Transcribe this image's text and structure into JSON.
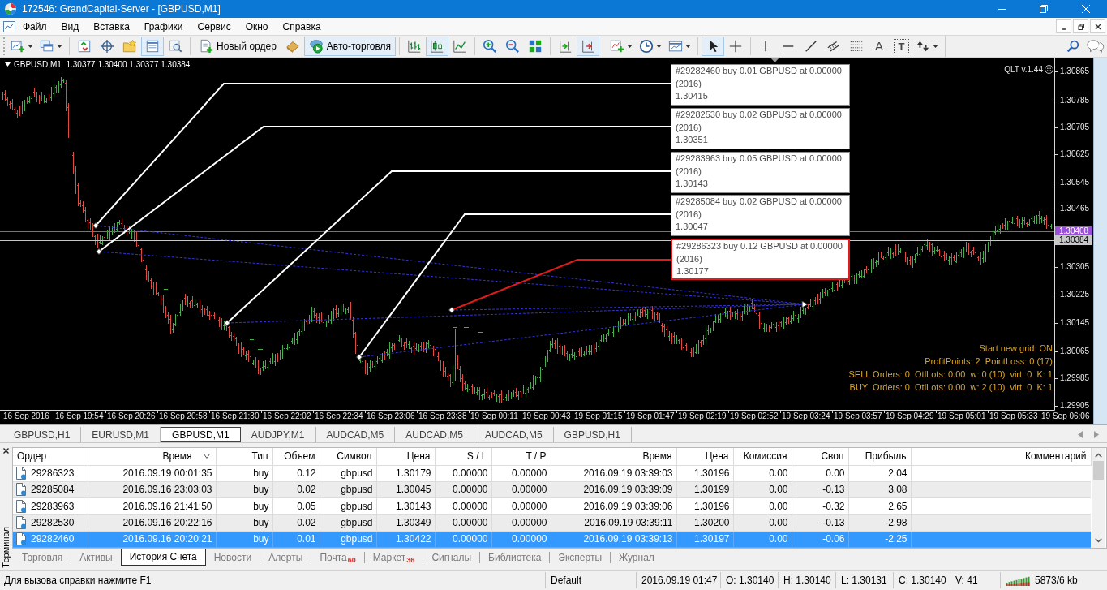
{
  "window": {
    "title": "172546: GrandCapital-Server - [GBPUSD,M1]"
  },
  "menu": [
    "Файл",
    "Вид",
    "Вставка",
    "Графики",
    "Сервис",
    "Окно",
    "Справка"
  ],
  "toolbar": {
    "groups": [
      [
        {
          "kind": "icon",
          "pressed": false,
          "dropdown": true
        },
        {
          "kind": "icon",
          "pressed": false,
          "dropdown": true
        }
      ],
      [
        {
          "kind": "icon",
          "pressed": false,
          "dropdown": false
        },
        {
          "kind": "icon",
          "pressed": false,
          "dropdown": false
        },
        {
          "kind": "icon",
          "pressed": false,
          "dropdown": false
        },
        {
          "kind": "icon",
          "pressed": true,
          "dropdown": false
        },
        {
          "kind": "icon",
          "pressed": false,
          "dropdown": false
        }
      ],
      [
        {
          "kind": "labeled",
          "label": "Новый ордер",
          "pressed": false,
          "dropdown": false
        },
        {
          "kind": "icon",
          "pressed": false,
          "dropdown": false
        },
        {
          "kind": "labeled",
          "label": "Авто-торговля",
          "pressed": true,
          "dropdown": false
        }
      ],
      [
        {
          "kind": "icon",
          "pressed": false,
          "dropdown": false
        },
        {
          "kind": "icon",
          "pressed": true,
          "dropdown": false
        },
        {
          "kind": "icon",
          "pressed": false,
          "dropdown": false
        }
      ],
      [
        {
          "kind": "icon",
          "pressed": false,
          "dropdown": false
        },
        {
          "kind": "icon",
          "pressed": false,
          "dropdown": false
        },
        {
          "kind": "icon",
          "pressed": false,
          "dropdown": false
        }
      ],
      [
        {
          "kind": "icon",
          "pressed": false,
          "dropdown": false
        },
        {
          "kind": "icon",
          "pressed": true,
          "dropdown": false
        }
      ],
      [
        {
          "kind": "icon",
          "pressed": false,
          "dropdown": true
        },
        {
          "kind": "icon",
          "pressed": false,
          "dropdown": true
        },
        {
          "kind": "icon",
          "pressed": false,
          "dropdown": true
        }
      ],
      [
        {
          "kind": "icon",
          "pressed": true,
          "dropdown": false
        },
        {
          "kind": "icon",
          "pressed": false,
          "dropdown": false
        }
      ],
      [
        {
          "kind": "icon",
          "pressed": false,
          "dropdown": false
        },
        {
          "kind": "icon",
          "pressed": false,
          "dropdown": false
        },
        {
          "kind": "icon",
          "pressed": false,
          "dropdown": false
        },
        {
          "kind": "icon",
          "pressed": false,
          "dropdown": false
        },
        {
          "kind": "icon",
          "pressed": false,
          "dropdown": false
        },
        {
          "kind": "glyph",
          "label": "A",
          "pressed": false,
          "dropdown": false
        },
        {
          "kind": "boxed-glyph",
          "label": "T",
          "pressed": false,
          "dropdown": false
        },
        {
          "kind": "icon",
          "pressed": false,
          "dropdown": true
        }
      ]
    ],
    "right": [
      {
        "kind": "icon",
        "pressed": false,
        "dropdown": false
      },
      {
        "kind": "icon",
        "pressed": false,
        "dropdown": false
      }
    ]
  },
  "chart": {
    "header": "GBPUSD,M1  1.30377 1.30400 1.30377 1.30384",
    "indicator": "QLT v.1.44",
    "trade_labels": [
      {
        "lines": [
          "#29282460 buy 0.01 GBPUSD at 0.00000",
          "(2016)",
          "1.30415"
        ],
        "selected": false
      },
      {
        "lines": [
          "#29282530 buy 0.02 GBPUSD at 0.00000",
          "(2016)",
          "1.30351"
        ],
        "selected": false
      },
      {
        "lines": [
          "#29283963 buy 0.05 GBPUSD at 0.00000",
          "(2016)",
          "1.30143"
        ],
        "selected": false
      },
      {
        "lines": [
          "#29285084 buy 0.02 GBPUSD at 0.00000",
          "(2016)",
          "1.30047"
        ],
        "selected": false
      },
      {
        "lines": [
          "#29286323 buy 0.12 GBPUSD at 0.00000",
          "(2016)",
          "1.30177"
        ],
        "selected": true
      }
    ],
    "info_lines": [
      "Start new grid: ON",
      "ProfitPoints: 2  PointLoss: 0 (17)",
      "SELL Orders: 0  OtlLots: 0.00  w: 0 (10)  virt: 0  K: 1",
      "BUY  Orders: 0  OtlLots: 0.00  w: 2 (10)  virt: 0  K: 1"
    ],
    "price_axis": [
      "1.30865",
      "1.30785",
      "1.30705",
      "1.30625",
      "1.30545",
      "1.30465",
      "1.30305",
      "1.30225",
      "1.30145",
      "1.30065",
      "1.29985",
      "1.29905"
    ],
    "price_markers": [
      {
        "label": "1.30408",
        "color": "#9b4fd9"
      },
      {
        "label": "1.30384",
        "color": "#c8c8c8"
      }
    ],
    "time_axis": [
      "16 Sep 2016",
      "16 Sep 19:54",
      "16 Sep 20:26",
      "16 Sep 20:58",
      "16 Sep 21:30",
      "16 Sep 22:02",
      "16 Sep 22:34",
      "16 Sep 23:06",
      "16 Sep 23:38",
      "19 Sep 00:11",
      "19 Sep 00:43",
      "19 Sep 01:15",
      "19 Sep 01:47",
      "19 Sep 02:19",
      "19 Sep 02:52",
      "19 Sep 03:24",
      "19 Sep 03:57",
      "19 Sep 04:29",
      "19 Sep 05:01",
      "19 Sep 05:33",
      "19 Sep 06:06"
    ]
  },
  "chart_tabs": [
    {
      "label": "GBPUSD,H1",
      "selected": false
    },
    {
      "label": "EURUSD,M1",
      "selected": false
    },
    {
      "label": "GBPUSD,M1",
      "selected": true
    },
    {
      "label": "AUDJPY,M1",
      "selected": false
    },
    {
      "label": "AUDCAD,M5",
      "selected": false
    },
    {
      "label": "AUDCAD,M5",
      "selected": false
    },
    {
      "label": "AUDCAD,M5",
      "selected": false
    },
    {
      "label": "GBPUSD,H1",
      "selected": false
    }
  ],
  "terminal": {
    "title": "Терминал",
    "columns": [
      {
        "label": "Ордер",
        "sorted": false
      },
      {
        "label": "Время",
        "sorted": true
      },
      {
        "label": "Тип",
        "sorted": false
      },
      {
        "label": "Объем",
        "sorted": false
      },
      {
        "label": "Символ",
        "sorted": false
      },
      {
        "label": "Цена",
        "sorted": false
      },
      {
        "label": "S / L",
        "sorted": false
      },
      {
        "label": "T / P",
        "sorted": false
      },
      {
        "label": "Время",
        "sorted": false
      },
      {
        "label": "Цена",
        "sorted": false
      },
      {
        "label": "Комиссия",
        "sorted": false
      },
      {
        "label": "Своп",
        "sorted": false
      },
      {
        "label": "Прибыль",
        "sorted": false
      },
      {
        "label": "Комментарий",
        "sorted": false
      }
    ],
    "rows": [
      {
        "cells": [
          "29286323",
          "2016.09.19 00:01:35",
          "buy",
          "0.12",
          "gbpusd",
          "1.30179",
          "0.00000",
          "0.00000",
          "2016.09.19 03:39:03",
          "1.30196",
          "0.00",
          "0.00",
          "2.04"
        ],
        "selected": false
      },
      {
        "cells": [
          "29285084",
          "2016.09.16 23:03:03",
          "buy",
          "0.02",
          "gbpusd",
          "1.30045",
          "0.00000",
          "0.00000",
          "2016.09.19 03:39:09",
          "1.30199",
          "0.00",
          "-0.13",
          "3.08"
        ],
        "selected": false
      },
      {
        "cells": [
          "29283963",
          "2016.09.16 21:41:50",
          "buy",
          "0.05",
          "gbpusd",
          "1.30143",
          "0.00000",
          "0.00000",
          "2016.09.19 03:39:06",
          "1.30196",
          "0.00",
          "-0.32",
          "2.65"
        ],
        "selected": false
      },
      {
        "cells": [
          "29282530",
          "2016.09.16 20:22:16",
          "buy",
          "0.02",
          "gbpusd",
          "1.30349",
          "0.00000",
          "0.00000",
          "2016.09.19 03:39:11",
          "1.30200",
          "0.00",
          "-0.13",
          "-2.98"
        ],
        "selected": false
      },
      {
        "cells": [
          "29282460",
          "2016.09.16 20:20:21",
          "buy",
          "0.01",
          "gbpusd",
          "1.30422",
          "0.00000",
          "0.00000",
          "2016.09.19 03:39:13",
          "1.30197",
          "0.00",
          "-0.06",
          "-2.25"
        ],
        "selected": true
      }
    ],
    "tabs": [
      {
        "label": "Торговля",
        "selected": false
      },
      {
        "label": "Активы",
        "selected": false
      },
      {
        "label": "История Счета",
        "selected": true
      },
      {
        "label": "Новости",
        "selected": false
      },
      {
        "label": "Алерты",
        "selected": false
      },
      {
        "label": "Почта",
        "badge": "60",
        "selected": false
      },
      {
        "label": "Маркет",
        "badge": "36",
        "selected": false
      },
      {
        "label": "Сигналы",
        "selected": false
      },
      {
        "label": "Библиотека",
        "selected": false
      },
      {
        "label": "Эксперты",
        "selected": false
      },
      {
        "label": "Журнал",
        "selected": false
      }
    ]
  },
  "status_bar": {
    "help": "Для вызова справки нажмите F1",
    "fields": [
      "Default",
      "2016.09.19 01:47",
      "O: 1.30140",
      "H: 1.30140",
      "L: 1.30131",
      "C: 1.30140",
      "V: 41"
    ],
    "traffic": "5873/6 kb"
  }
}
